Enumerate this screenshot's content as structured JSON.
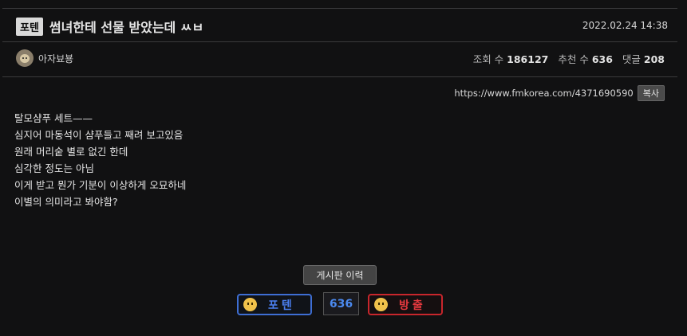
{
  "post": {
    "category": "포텐",
    "title": "썸녀한테 선물 받았는데 ㅆㅂ",
    "date": "2022.02.24 14:38",
    "author": "아자뵤뵹",
    "stats": {
      "views_label": "조회 수",
      "views": "186127",
      "recommend_label": "추천 수",
      "recommend": "636",
      "comments_label": "댓글",
      "comments": "208"
    },
    "url": "https://www.fmkorea.com/4371690590",
    "copy_label": "복사",
    "content": [
      "탈모샴푸 세트——",
      "심지어 마동석이 샴푸들고 째려 보고있음",
      "원래 머리숱 별로 없긴 한데",
      "심각한 정도는 아님",
      "이게 받고 뭔가 기분이 이상하게 오묘하네",
      "이별의 의미라고 봐야함?"
    ]
  },
  "actions": {
    "history_label": "게시판 이력",
    "upvote_label": "포텐",
    "vote_count": "636",
    "downvote_label": "방출"
  },
  "colors": {
    "upvote": "#3e6ed3",
    "downvote": "#c8262c",
    "count": "#4b8af0"
  }
}
